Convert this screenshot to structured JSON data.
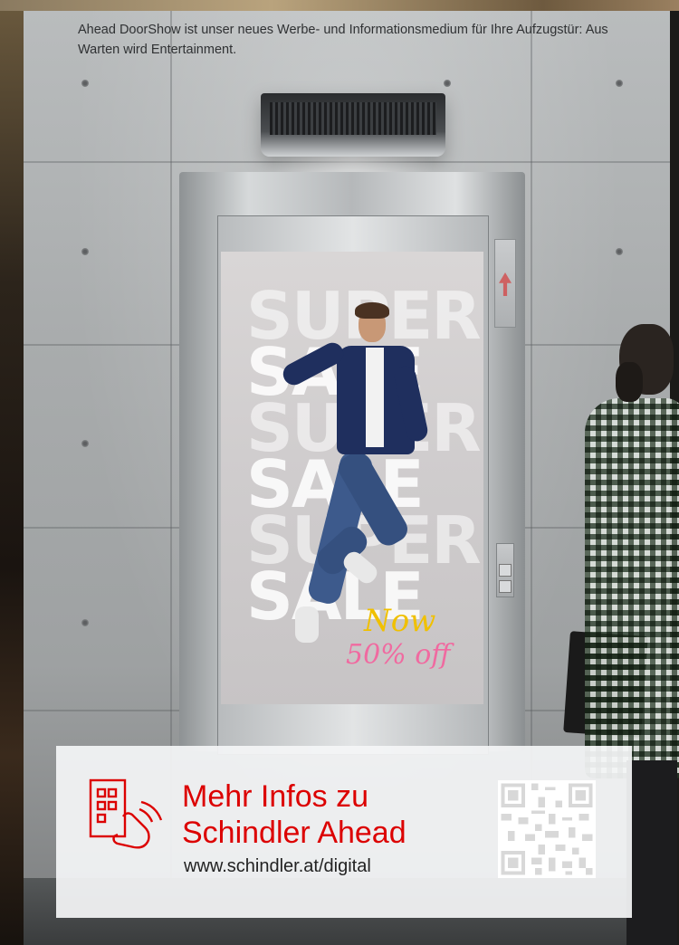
{
  "intro_text": "Ahead DoorShow ist unser neues Werbe- und Informationsmedium für Ihre Aufzugstür: Aus Warten wird Entertainment.",
  "poster": {
    "words": [
      "SUPER",
      "SALE",
      "SUPER",
      "SALE",
      "SUPER",
      "SALE"
    ],
    "now_label": "Now",
    "off_label": "50% off"
  },
  "info_card": {
    "title": "Mehr Infos zu\nSchindler Ahead",
    "url": "www.schindler.at/digital",
    "icon": "building-touch-icon",
    "accent_color": "#dc0000"
  }
}
